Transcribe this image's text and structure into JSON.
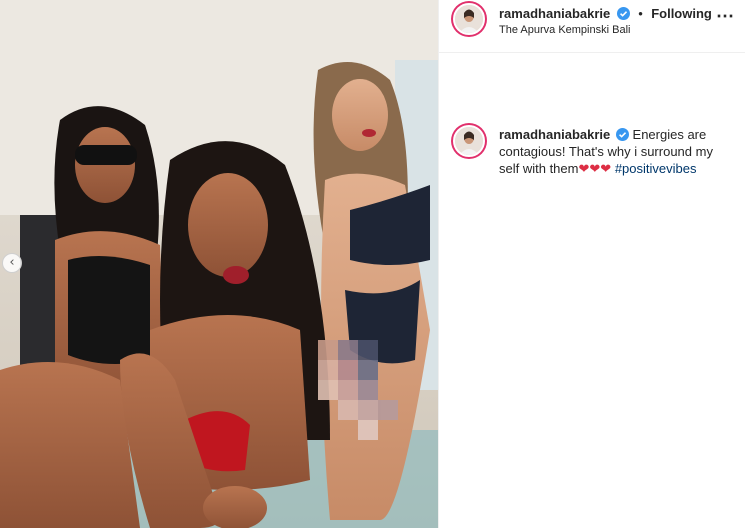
{
  "post": {
    "username": "ramadhaniabakrie",
    "separator": "•",
    "follow_status": "Following",
    "location": "The Apurva Kempinski Bali",
    "more_icon": "⋯"
  },
  "caption": {
    "username": "ramadhaniabakrie",
    "text": "Energies are contagious! That's why i surround my self with them",
    "hearts": [
      "❤",
      "❤",
      "❤"
    ],
    "hashtag": "#positivevibes"
  },
  "carousel": {
    "prev_glyph": "‹"
  },
  "colors": {
    "story_ring": "#e1306c",
    "verified": "#3897f0",
    "hashtag": "#00376b",
    "heart": "#dd2e44"
  }
}
